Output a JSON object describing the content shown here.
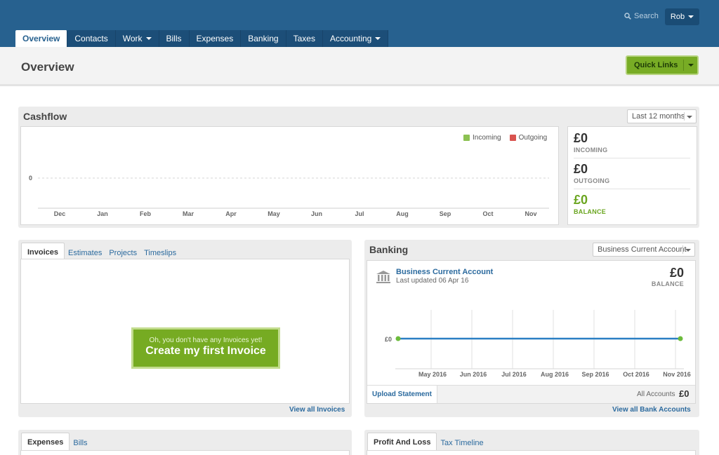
{
  "topbar": {
    "search_label": "Search",
    "user_name": "Rob"
  },
  "nav": [
    {
      "label": "Overview",
      "has_menu": false
    },
    {
      "label": "Contacts",
      "has_menu": false
    },
    {
      "label": "Work",
      "has_menu": true
    },
    {
      "label": "Bills",
      "has_menu": false
    },
    {
      "label": "Expenses",
      "has_menu": false
    },
    {
      "label": "Banking",
      "has_menu": false
    },
    {
      "label": "Taxes",
      "has_menu": false
    },
    {
      "label": "Accounting",
      "has_menu": true
    }
  ],
  "header": {
    "title": "Overview",
    "quick_links": "Quick Links"
  },
  "cashflow": {
    "title": "Cashflow",
    "period": "Last 12 months",
    "legend_incoming": "Incoming",
    "legend_outgoing": "Outgoing",
    "incoming_color": "#8cc152",
    "outgoing_color": "#d9534f",
    "stats": {
      "incoming_amount": "£0",
      "incoming_label": "INCOMING",
      "outgoing_amount": "£0",
      "outgoing_label": "OUTGOING",
      "balance_amount": "£0",
      "balance_label": "BALANCE"
    }
  },
  "invoices": {
    "tabs": [
      "Invoices",
      "Estimates",
      "Projects",
      "Timeslips"
    ],
    "empty_hint": "Oh, you don't have any Invoices yet!",
    "cta": "Create my first Invoice",
    "view_all": "View all Invoices"
  },
  "banking": {
    "title": "Banking",
    "account_select": "Business Current Account",
    "account_name": "Business Current Account",
    "last_updated": "Last updated 06 Apr 16",
    "balance_amount": "£0",
    "balance_label": "BALANCE",
    "upload": "Upload Statement",
    "all_accounts_label": "All Accounts",
    "all_accounts_amount": "£0",
    "view_all": "View all Bank Accounts",
    "line_color": "#2a7fc4",
    "point_color": "#6cbb3c"
  },
  "expenses": {
    "tabs": [
      "Expenses",
      "Bills"
    ]
  },
  "profit": {
    "tabs": [
      "Profit And Loss",
      "Tax Timeline"
    ]
  },
  "chart_data": [
    {
      "type": "line",
      "title": "Cashflow",
      "categories": [
        "Dec",
        "Jan",
        "Feb",
        "Mar",
        "Apr",
        "May",
        "Jun",
        "Jul",
        "Aug",
        "Sep",
        "Oct",
        "Nov"
      ],
      "series": [
        {
          "name": "Incoming",
          "values": [
            0,
            0,
            0,
            0,
            0,
            0,
            0,
            0,
            0,
            0,
            0,
            0
          ]
        },
        {
          "name": "Outgoing",
          "values": [
            0,
            0,
            0,
            0,
            0,
            0,
            0,
            0,
            0,
            0,
            0,
            0
          ]
        }
      ],
      "y_ticks": [
        "0"
      ],
      "legend": "top-right"
    },
    {
      "type": "line",
      "title": "",
      "categories": [
        "May 2016",
        "Jun 2016",
        "Jul 2016",
        "Aug 2016",
        "Sep 2016",
        "Oct 2016",
        "Nov 2016"
      ],
      "series": [
        {
          "values": [
            0,
            0
          ]
        }
      ],
      "y_ticks": [
        "£0"
      ]
    }
  ]
}
